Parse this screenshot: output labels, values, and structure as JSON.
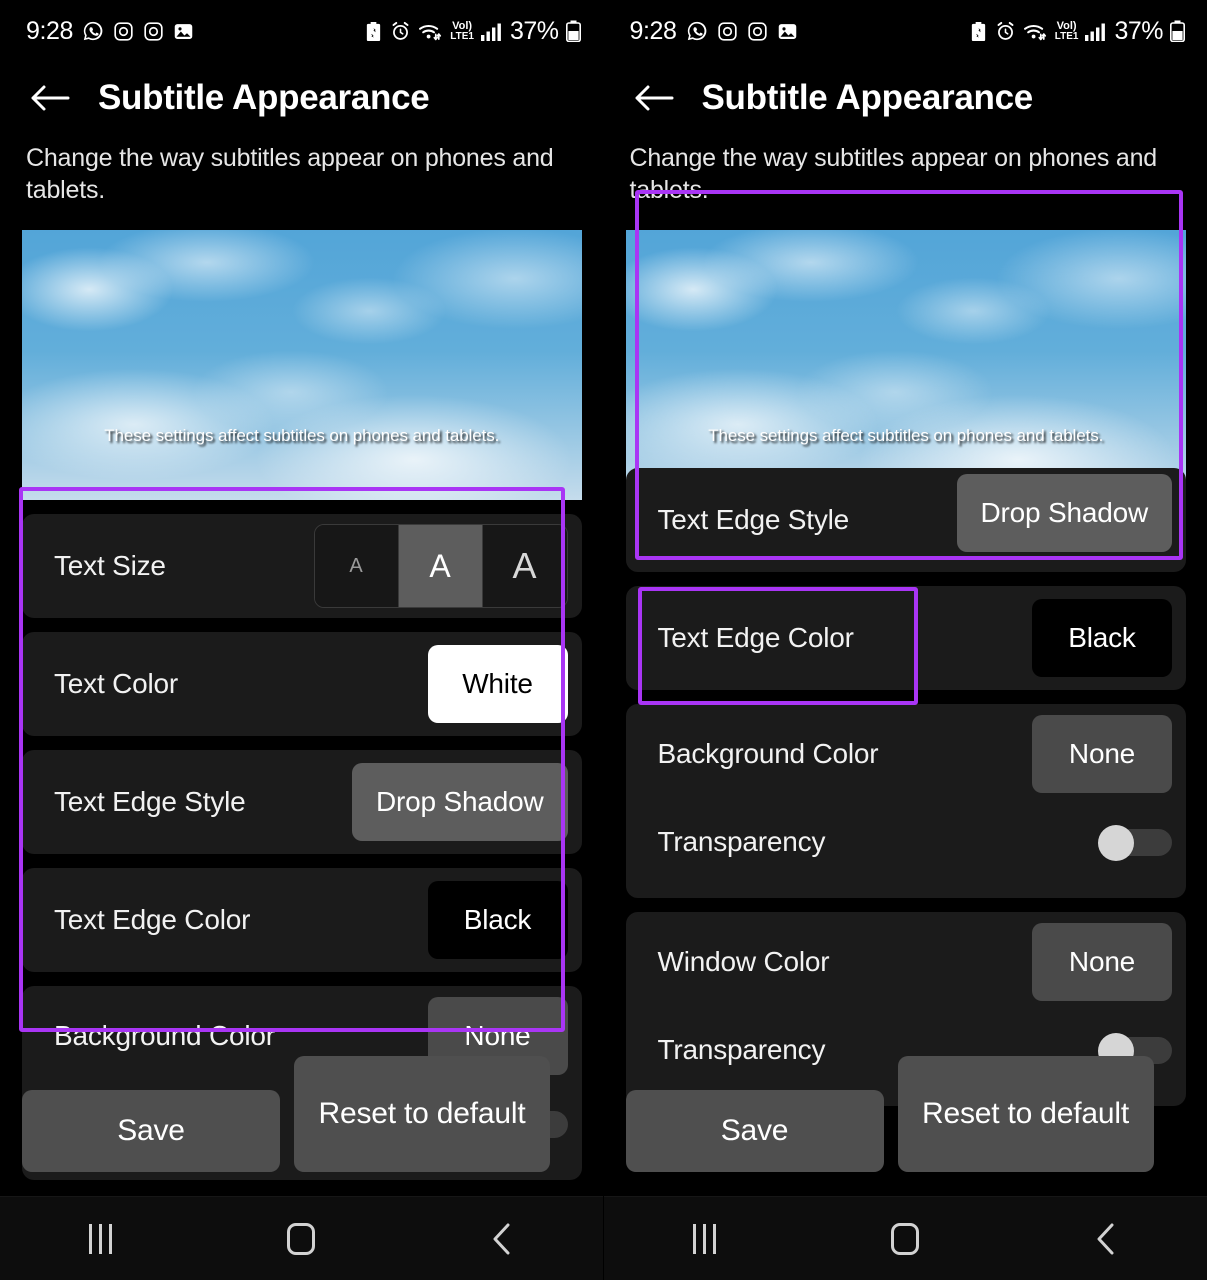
{
  "colors": {
    "accent_highlight": "#a935f5",
    "row_bg": "#1b1b1b",
    "pill_gray": "#5d5d5d",
    "button_gray": "#4f4f4f",
    "screen_bg": "#000000",
    "preview_sky": "#53a5d8"
  },
  "status_bar": {
    "time": "9:28",
    "battery_percent": "37%",
    "network_label_top": "Vol)",
    "network_label_bottom": "LTE1",
    "left_icons": [
      "whatsapp-icon",
      "instagram-icon",
      "instagram-icon",
      "photos-icon"
    ],
    "right_icons": [
      "battery-saver-icon",
      "alarm-icon",
      "wifi-icon",
      "volte-icon",
      "signal-bars-icon",
      "battery-icon"
    ]
  },
  "header": {
    "back_icon": "back-arrow-icon",
    "title": "Subtitle Appearance"
  },
  "description": "Change the way subtitles appear on phones and tablets.",
  "preview": {
    "caption": "These settings affect subtitles on phones and tablets."
  },
  "settings": {
    "text_size": {
      "label": "Text Size",
      "options": [
        "A",
        "A",
        "A"
      ],
      "selected_index": 1
    },
    "text_color": {
      "label": "Text Color",
      "value": "White"
    },
    "text_edge_style": {
      "label": "Text Edge Style",
      "value": "Drop Shadow"
    },
    "text_edge_color": {
      "label": "Text Edge Color",
      "value": "Black"
    },
    "background_color": {
      "label": "Background Color",
      "value": "None"
    },
    "background_transparency": {
      "label": "Transparency",
      "state": "off"
    },
    "window_color": {
      "label": "Window Color",
      "value": "None"
    },
    "window_transparency": {
      "label": "Transparency",
      "state": "off"
    }
  },
  "buttons": {
    "save": "Save",
    "reset": "Reset to default"
  },
  "nav_bar": {
    "recents": "recents-icon",
    "home": "home-icon",
    "back": "back-nav-icon"
  }
}
